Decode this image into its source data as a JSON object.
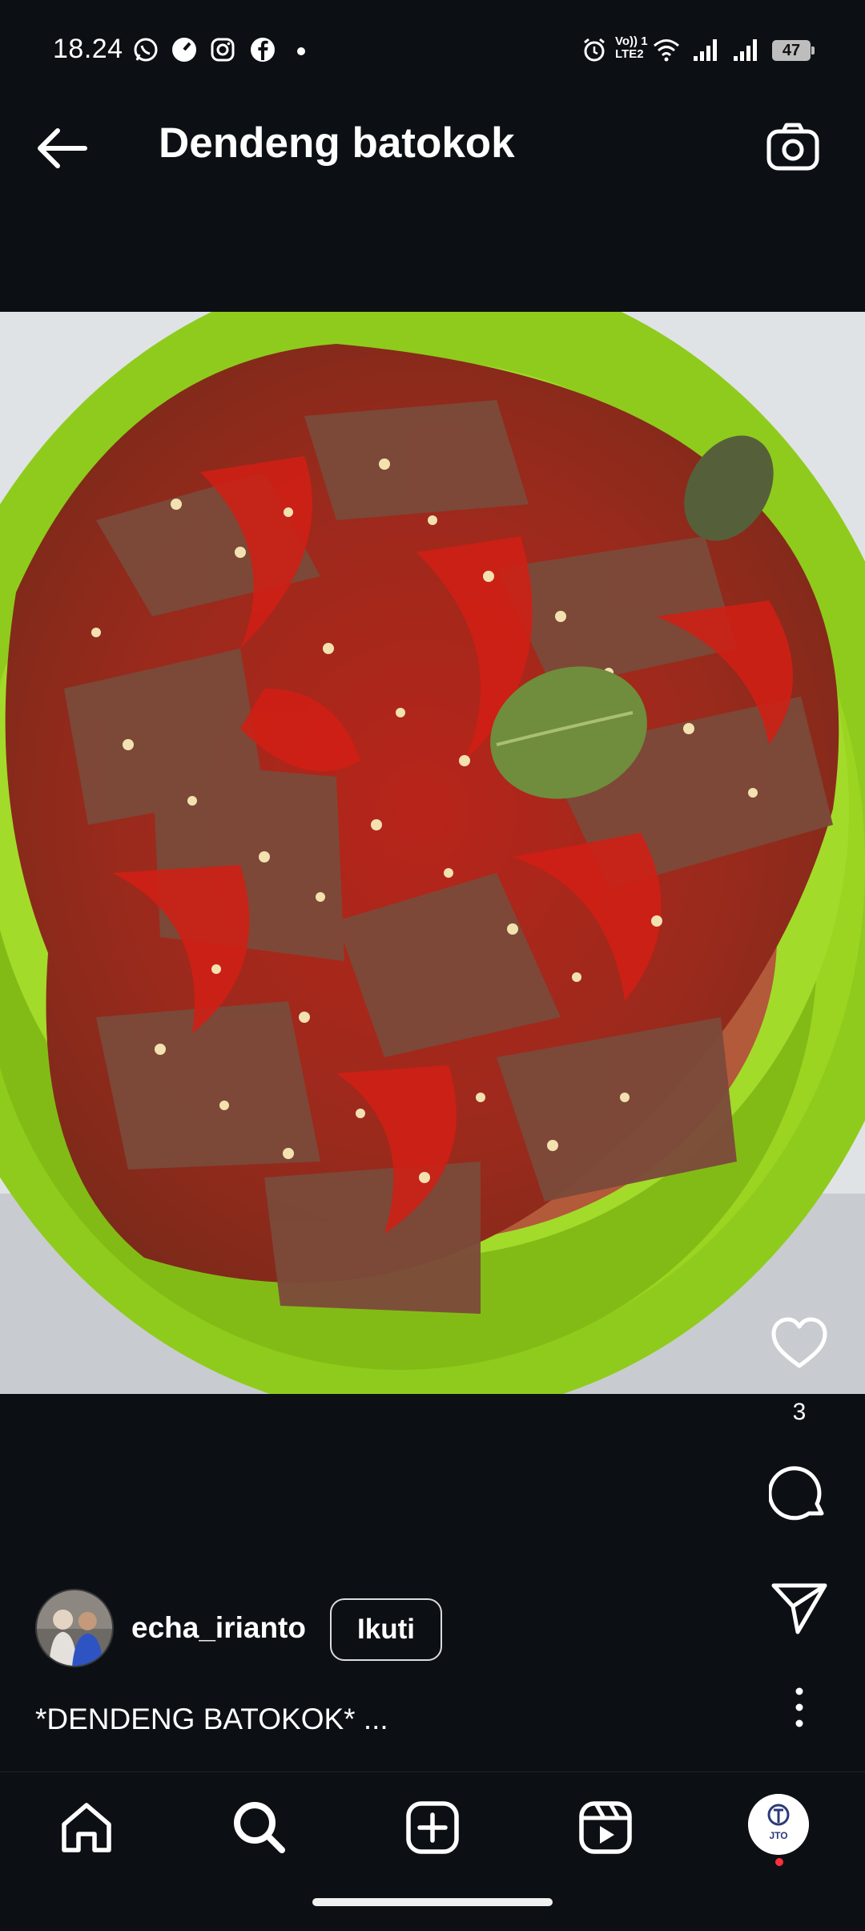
{
  "status_bar": {
    "time": "18.24",
    "battery": "47",
    "network_top": "Vo)) 1",
    "network_bottom": "LTE2"
  },
  "header": {
    "title": "Dendeng batokok"
  },
  "post": {
    "likes": "3",
    "author": "echa_irianto",
    "follow_label": "Ikuti",
    "caption": "*DENDENG BATOKOK* ..."
  },
  "profile_avatar_text": "JTO",
  "colors": {
    "background": "#0c1014",
    "text": "#f5f5f5",
    "plate_green": "#9cd521",
    "notification_dot": "#ff2f40"
  }
}
